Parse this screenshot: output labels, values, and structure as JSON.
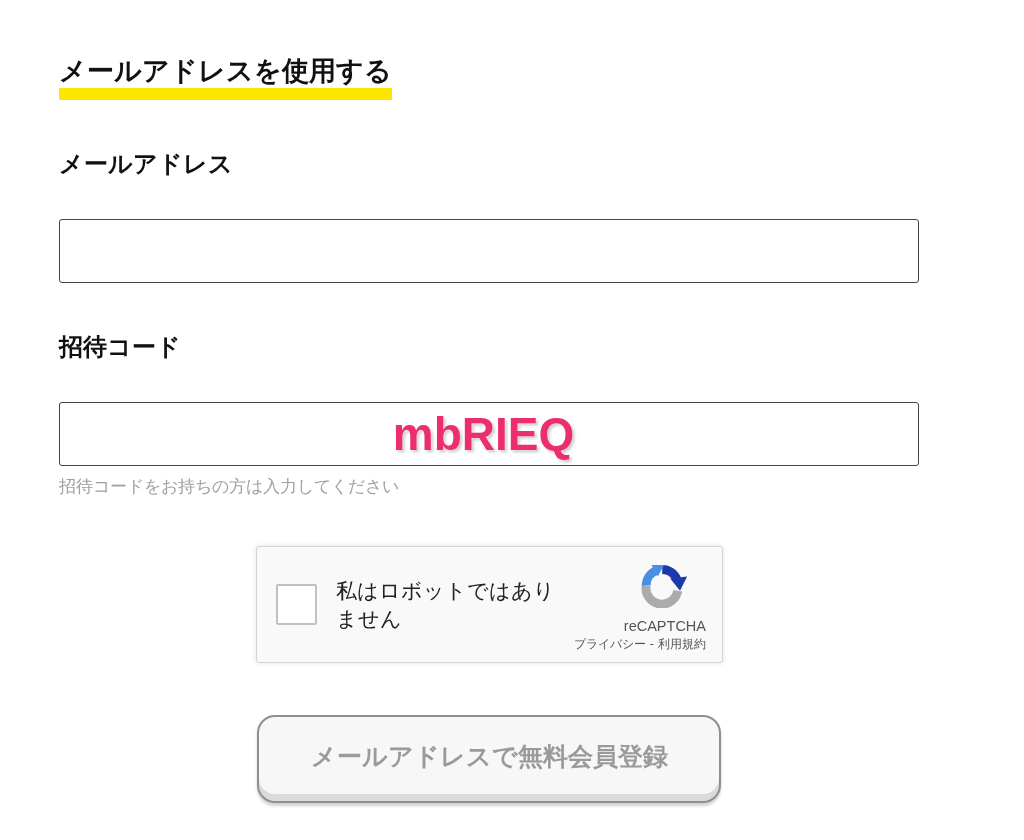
{
  "section": {
    "title": "メールアドレスを使用する"
  },
  "fields": [
    {
      "label": "メールアドレス"
    },
    {
      "label": "招待コード",
      "annotation": "mbRIEQ",
      "hint": "招待コードをお持ちの方は入力してください"
    }
  ],
  "captcha": {
    "checked": false,
    "label": "私はロボットではありません",
    "brand": "reCAPTCHA",
    "privacy_link": "プライバシー",
    "separator": "-",
    "terms_link": "利用規約"
  },
  "submit_button": {
    "label": "メールアドレスで無料会員登録",
    "disabled": true
  }
}
